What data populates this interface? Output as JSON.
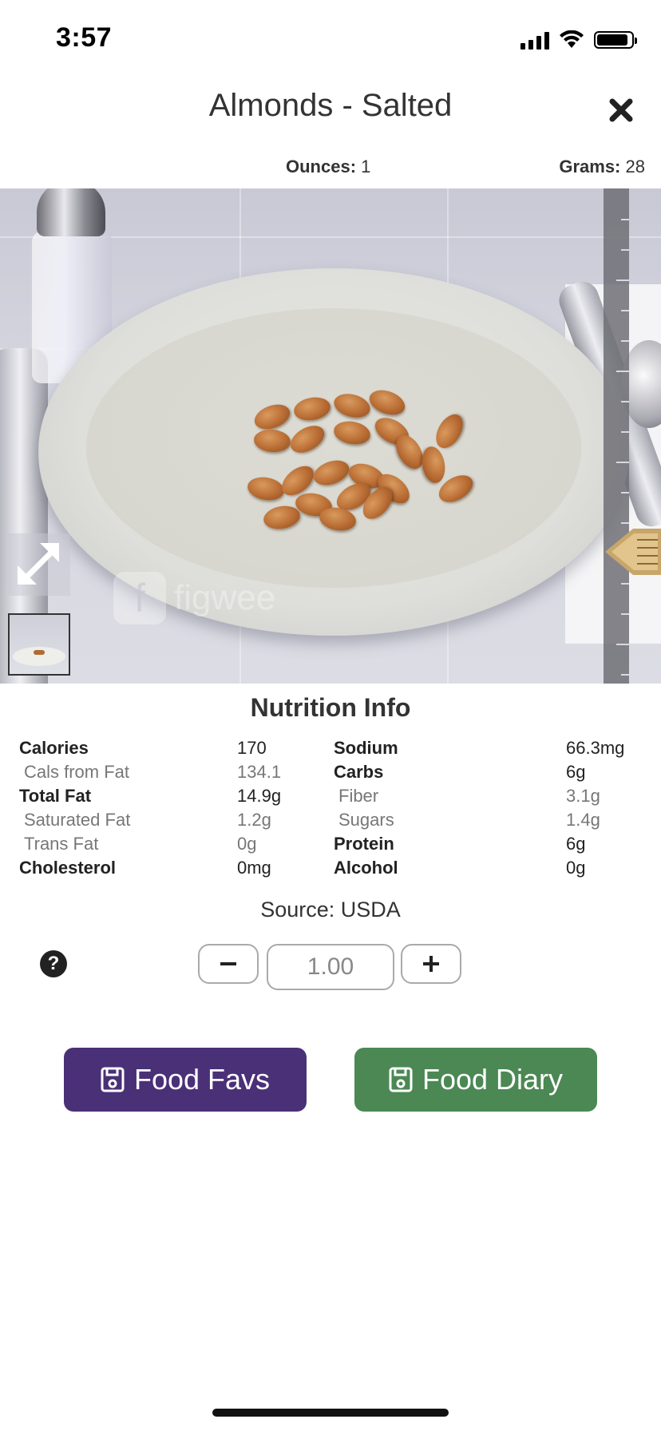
{
  "status_bar": {
    "time": "3:57"
  },
  "header": {
    "title": "Almonds - Salted"
  },
  "portion": {
    "ounces_label": "Ounces:",
    "ounces_value": "1",
    "grams_label": "Grams:",
    "grams_value": "28"
  },
  "photo": {
    "watermark": "figwee"
  },
  "nutrition": {
    "title": "Nutrition Info",
    "left": [
      {
        "label": "Calories",
        "value": "170",
        "style": "bold"
      },
      {
        "label": "Cals from Fat",
        "value": "134.1",
        "style": "sub"
      },
      {
        "label": "Total Fat",
        "value": "14.9g",
        "style": "bold"
      },
      {
        "label": "Saturated Fat",
        "value": "1.2g",
        "style": "sub"
      },
      {
        "label": "Trans Fat",
        "value": "0g",
        "style": "sub"
      },
      {
        "label": "Cholesterol",
        "value": "0mg",
        "style": "bold"
      }
    ],
    "right": [
      {
        "label": "Sodium",
        "value": "66.3mg",
        "style": "bold"
      },
      {
        "label": "Carbs",
        "value": "6g",
        "style": "bold"
      },
      {
        "label": "Fiber",
        "value": "3.1g",
        "style": "sub"
      },
      {
        "label": "Sugars",
        "value": "1.4g",
        "style": "sub"
      },
      {
        "label": "Protein",
        "value": "6g",
        "style": "bold"
      },
      {
        "label": "Alcohol",
        "value": "0g",
        "style": "bold"
      }
    ]
  },
  "source": "Source: USDA",
  "quantity": {
    "value": "1.00"
  },
  "buttons": {
    "favs_label": "Food Favs",
    "diary_label": "Food Diary"
  },
  "colors": {
    "favs_button": "#4a3077",
    "diary_button": "#4b8854"
  },
  "icons": [
    "close-icon",
    "expand-icon",
    "help-icon",
    "minus-icon",
    "plus-icon",
    "save-icon"
  ]
}
